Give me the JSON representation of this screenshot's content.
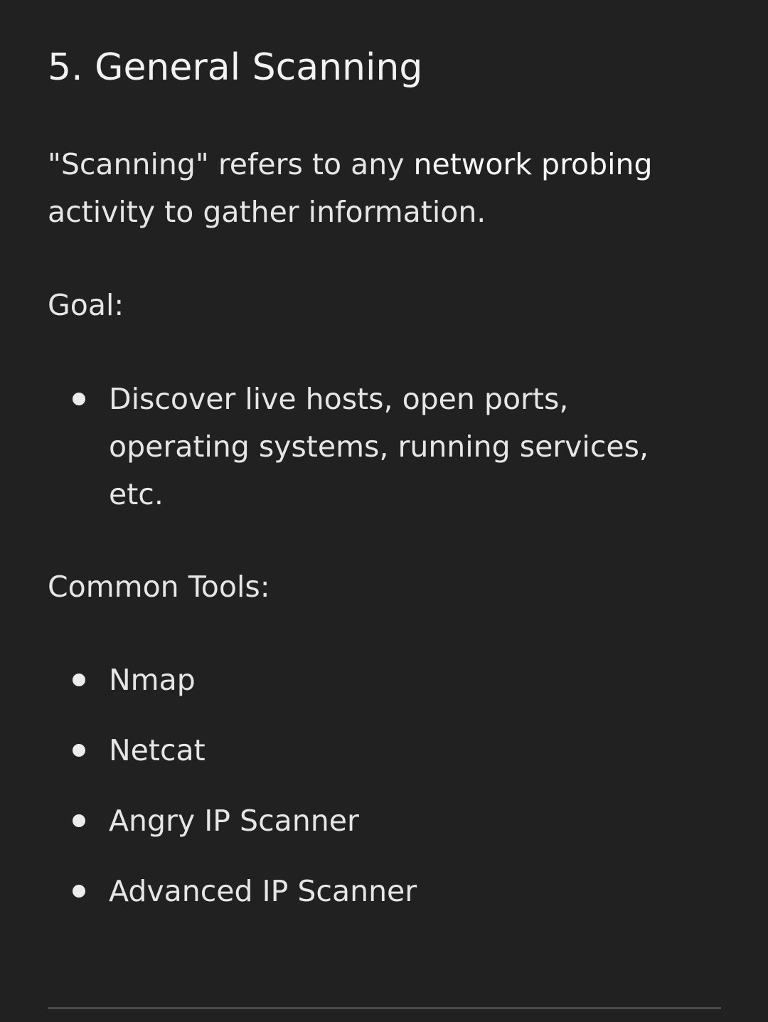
{
  "section": {
    "heading": "5. General Scanning",
    "intro": {
      "before": "\"Scanning\" refers to any ",
      "emphasis": "network probing",
      "after": " activity to gather information."
    },
    "goal_label": "Goal:",
    "goal_items": [
      "Discover live hosts, open ports, operating systems, running services, etc."
    ],
    "tools_label": "Common Tools:",
    "tools": [
      "Nmap",
      "Netcat",
      "Angry IP Scanner",
      "Advanced IP Scanner"
    ]
  }
}
